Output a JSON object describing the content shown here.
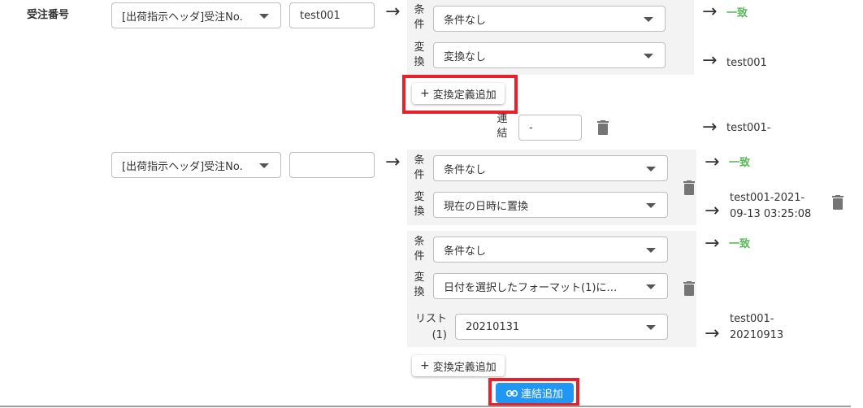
{
  "field": {
    "label": "受注番号"
  },
  "row1": {
    "source_select": "[出荷指示ヘッダ]受注No.",
    "value_input": "test001",
    "condition_label": "条件",
    "condition_select": "条件なし",
    "conversion_label": "変換",
    "conversion_select": "変換なし",
    "match_text": "一致",
    "result_text": "test001",
    "add_conversion_label": "変換定義追加"
  },
  "concat": {
    "label": "連結",
    "input_value": "-",
    "result_text": "test001-"
  },
  "row2": {
    "source_select": "[出荷指示ヘッダ]受注No.",
    "value_input": "",
    "block1": {
      "condition_label": "条件",
      "condition_select": "条件なし",
      "conversion_label": "変換",
      "conversion_select": "現在の日時に置換",
      "match_text": "一致",
      "result_line1": "test001-2021-",
      "result_line2": "09-13 03:25:08"
    },
    "block2": {
      "condition_label": "条件",
      "condition_select": "条件なし",
      "conversion_label": "変換",
      "conversion_select": "日付を選択したフォーマット(1)に…",
      "list_label_line1": "リスト",
      "list_label_line2": "(1)",
      "list_select": "20210131",
      "match_text": "一致",
      "result_line1": "test001-",
      "result_line2": "20210913"
    },
    "add_conversion_label": "変換定義追加",
    "add_link_label": "連結追加"
  },
  "icons": {
    "arrow": "→",
    "plus": "+",
    "trash": "trash-icon",
    "link": "link-icon"
  },
  "colors": {
    "match_green": "#5cb85c",
    "highlight_red": "#e8202a",
    "primary_blue": "#2196f3"
  }
}
